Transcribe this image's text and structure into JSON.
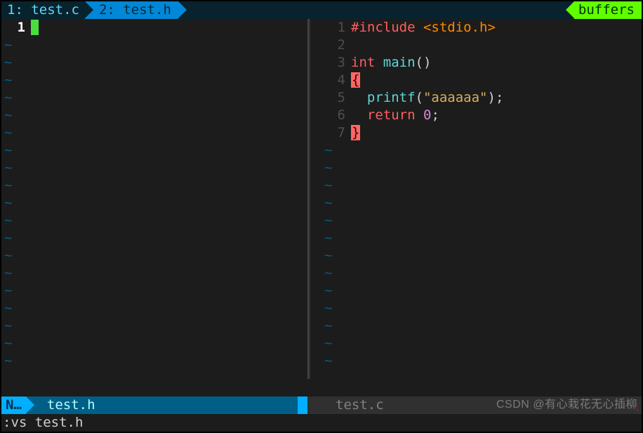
{
  "tabs": {
    "tab1": {
      "num": "1:",
      "name": "test.c"
    },
    "tab2": {
      "num": "2:",
      "name": "test.h"
    },
    "buffers_label": "buffers"
  },
  "left": {
    "line1_num": "1",
    "tilde": "~"
  },
  "right": {
    "rows": [
      {
        "num": "1"
      },
      {
        "num": "2"
      },
      {
        "num": "3"
      },
      {
        "num": "4"
      },
      {
        "num": "5"
      },
      {
        "num": "6"
      },
      {
        "num": "7"
      }
    ],
    "code": {
      "l1_include": "#include",
      "l1_header": " <stdio.h>",
      "l3_int": "int",
      "l3_main": " main",
      "l3_parens": "()",
      "l4_brace": "{",
      "l5_printf": "printf",
      "l5_open": "(",
      "l5_str": "\"aaaaaa\"",
      "l5_close": ");",
      "l6_return": "return",
      "l6_sp": " ",
      "l6_zero": "0",
      "l6_semi": ";",
      "l7_brace": "}"
    },
    "tilde": "~"
  },
  "statusline": {
    "mode": "N…",
    "active_file": "test.h",
    "inactive_file": "test.c"
  },
  "cmdline": ":vs test.h",
  "watermark": "CSDN @有心栽花无心插柳"
}
